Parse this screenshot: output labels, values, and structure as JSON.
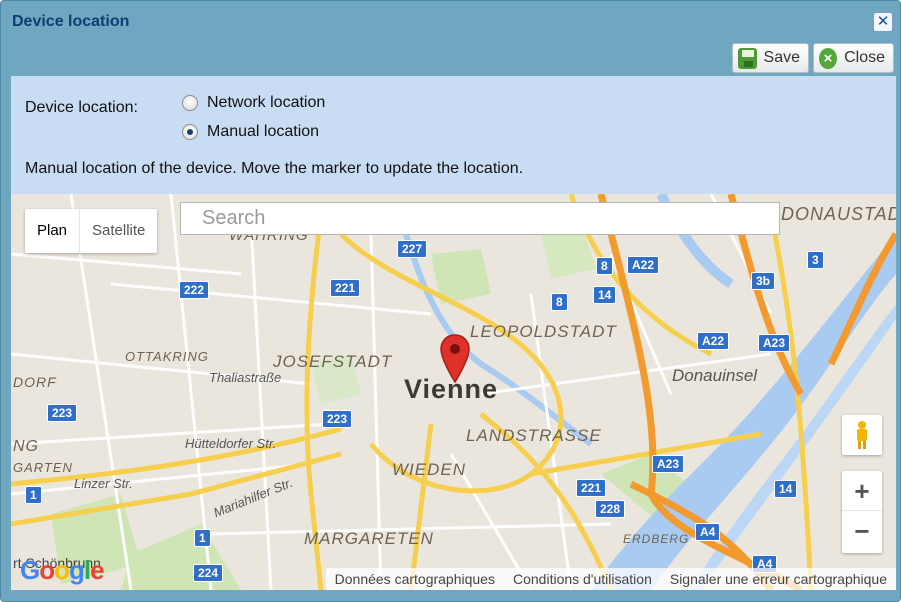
{
  "dialog": {
    "title": "Device location",
    "close_glyph": "✕",
    "toolbar": {
      "save_label": "Save",
      "close_label": "Close"
    }
  },
  "form": {
    "location_label": "Device location:",
    "options": [
      {
        "label": "Network location",
        "selected": false
      },
      {
        "label": "Manual location",
        "selected": true
      }
    ],
    "help_text": "Manual location of the device. Move the marker to update the location."
  },
  "map": {
    "type_tabs": {
      "plan": "Plan",
      "satellite": "Satellite"
    },
    "search_placeholder": "Search",
    "city": "Vienne",
    "districts": {
      "wahring": "WÄHRING",
      "leopoldstadt": "LEOPOLDSTADT",
      "josefstadt": "JOSEFSTADT",
      "ottakring": "OTTAKRING",
      "landstrasse": "LANDSTRASSE",
      "wieden": "WIEDEN",
      "margareten": "MARGARETEN",
      "donaustadt": "DONAUSTAD",
      "erdberg": "ERDBERG",
      "donauinsel": "Donauinsel"
    },
    "streets": {
      "thalia": "Thaliastraße",
      "huetteldorfer": "Hütteldorfer Str.",
      "linzer": "Linzer Str.",
      "mariahilfer": "Mariahilfer Str.",
      "schonbrunn": "rt Schönbrunn"
    },
    "partial_labels": {
      "dorf": "DORF",
      "ng": "NG",
      "garten": "GARTEN"
    },
    "route_shields": [
      "227",
      "221",
      "222",
      "8",
      "A22",
      "3",
      "8",
      "14",
      "3b",
      "A22",
      "A23",
      "223",
      "223",
      "A23",
      "1",
      "221",
      "228",
      "14",
      "1",
      "A4",
      "224",
      "A4"
    ],
    "zoom_in": "+",
    "zoom_out": "−",
    "logo_text": [
      "G",
      "o",
      "o",
      "g",
      "l",
      "e"
    ],
    "attribution": [
      "Données cartographiques",
      "Conditions d'utilisation",
      "Signaler une erreur cartographique"
    ]
  },
  "colors": {
    "dialog_bg": "#6fa7c1",
    "panel_bg": "#c8ddf3",
    "title_color": "#0e3e73",
    "road_major": "#f6cf4e",
    "highway": "#f29a2e",
    "water": "#a9cbf2",
    "park": "#cfe5b5",
    "shield_blue": "#2f6ec9",
    "marker_red": "#e0302a"
  }
}
